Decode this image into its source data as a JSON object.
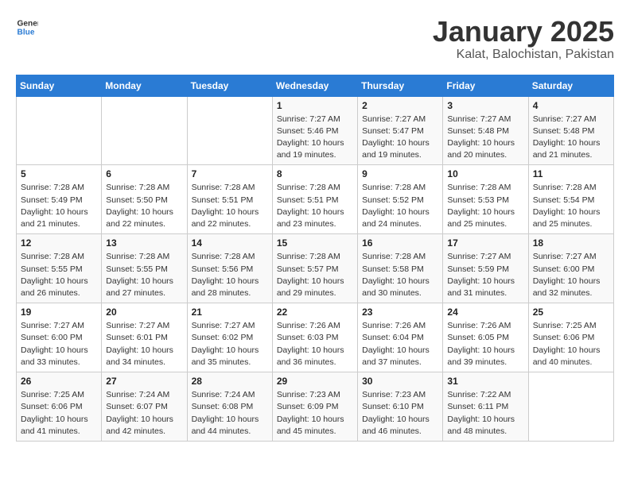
{
  "logo": {
    "line1": "General",
    "line2": "Blue"
  },
  "title": "January 2025",
  "subtitle": "Kalat, Balochistan, Pakistan",
  "days_header": [
    "Sunday",
    "Monday",
    "Tuesday",
    "Wednesday",
    "Thursday",
    "Friday",
    "Saturday"
  ],
  "weeks": [
    [
      {
        "day": "",
        "sunrise": "",
        "sunset": "",
        "daylight": ""
      },
      {
        "day": "",
        "sunrise": "",
        "sunset": "",
        "daylight": ""
      },
      {
        "day": "",
        "sunrise": "",
        "sunset": "",
        "daylight": ""
      },
      {
        "day": "1",
        "sunrise": "Sunrise: 7:27 AM",
        "sunset": "Sunset: 5:46 PM",
        "daylight": "Daylight: 10 hours and 19 minutes."
      },
      {
        "day": "2",
        "sunrise": "Sunrise: 7:27 AM",
        "sunset": "Sunset: 5:47 PM",
        "daylight": "Daylight: 10 hours and 19 minutes."
      },
      {
        "day": "3",
        "sunrise": "Sunrise: 7:27 AM",
        "sunset": "Sunset: 5:48 PM",
        "daylight": "Daylight: 10 hours and 20 minutes."
      },
      {
        "day": "4",
        "sunrise": "Sunrise: 7:27 AM",
        "sunset": "Sunset: 5:48 PM",
        "daylight": "Daylight: 10 hours and 21 minutes."
      }
    ],
    [
      {
        "day": "5",
        "sunrise": "Sunrise: 7:28 AM",
        "sunset": "Sunset: 5:49 PM",
        "daylight": "Daylight: 10 hours and 21 minutes."
      },
      {
        "day": "6",
        "sunrise": "Sunrise: 7:28 AM",
        "sunset": "Sunset: 5:50 PM",
        "daylight": "Daylight: 10 hours and 22 minutes."
      },
      {
        "day": "7",
        "sunrise": "Sunrise: 7:28 AM",
        "sunset": "Sunset: 5:51 PM",
        "daylight": "Daylight: 10 hours and 22 minutes."
      },
      {
        "day": "8",
        "sunrise": "Sunrise: 7:28 AM",
        "sunset": "Sunset: 5:51 PM",
        "daylight": "Daylight: 10 hours and 23 minutes."
      },
      {
        "day": "9",
        "sunrise": "Sunrise: 7:28 AM",
        "sunset": "Sunset: 5:52 PM",
        "daylight": "Daylight: 10 hours and 24 minutes."
      },
      {
        "day": "10",
        "sunrise": "Sunrise: 7:28 AM",
        "sunset": "Sunset: 5:53 PM",
        "daylight": "Daylight: 10 hours and 25 minutes."
      },
      {
        "day": "11",
        "sunrise": "Sunrise: 7:28 AM",
        "sunset": "Sunset: 5:54 PM",
        "daylight": "Daylight: 10 hours and 25 minutes."
      }
    ],
    [
      {
        "day": "12",
        "sunrise": "Sunrise: 7:28 AM",
        "sunset": "Sunset: 5:55 PM",
        "daylight": "Daylight: 10 hours and 26 minutes."
      },
      {
        "day": "13",
        "sunrise": "Sunrise: 7:28 AM",
        "sunset": "Sunset: 5:55 PM",
        "daylight": "Daylight: 10 hours and 27 minutes."
      },
      {
        "day": "14",
        "sunrise": "Sunrise: 7:28 AM",
        "sunset": "Sunset: 5:56 PM",
        "daylight": "Daylight: 10 hours and 28 minutes."
      },
      {
        "day": "15",
        "sunrise": "Sunrise: 7:28 AM",
        "sunset": "Sunset: 5:57 PM",
        "daylight": "Daylight: 10 hours and 29 minutes."
      },
      {
        "day": "16",
        "sunrise": "Sunrise: 7:28 AM",
        "sunset": "Sunset: 5:58 PM",
        "daylight": "Daylight: 10 hours and 30 minutes."
      },
      {
        "day": "17",
        "sunrise": "Sunrise: 7:27 AM",
        "sunset": "Sunset: 5:59 PM",
        "daylight": "Daylight: 10 hours and 31 minutes."
      },
      {
        "day": "18",
        "sunrise": "Sunrise: 7:27 AM",
        "sunset": "Sunset: 6:00 PM",
        "daylight": "Daylight: 10 hours and 32 minutes."
      }
    ],
    [
      {
        "day": "19",
        "sunrise": "Sunrise: 7:27 AM",
        "sunset": "Sunset: 6:00 PM",
        "daylight": "Daylight: 10 hours and 33 minutes."
      },
      {
        "day": "20",
        "sunrise": "Sunrise: 7:27 AM",
        "sunset": "Sunset: 6:01 PM",
        "daylight": "Daylight: 10 hours and 34 minutes."
      },
      {
        "day": "21",
        "sunrise": "Sunrise: 7:27 AM",
        "sunset": "Sunset: 6:02 PM",
        "daylight": "Daylight: 10 hours and 35 minutes."
      },
      {
        "day": "22",
        "sunrise": "Sunrise: 7:26 AM",
        "sunset": "Sunset: 6:03 PM",
        "daylight": "Daylight: 10 hours and 36 minutes."
      },
      {
        "day": "23",
        "sunrise": "Sunrise: 7:26 AM",
        "sunset": "Sunset: 6:04 PM",
        "daylight": "Daylight: 10 hours and 37 minutes."
      },
      {
        "day": "24",
        "sunrise": "Sunrise: 7:26 AM",
        "sunset": "Sunset: 6:05 PM",
        "daylight": "Daylight: 10 hours and 39 minutes."
      },
      {
        "day": "25",
        "sunrise": "Sunrise: 7:25 AM",
        "sunset": "Sunset: 6:06 PM",
        "daylight": "Daylight: 10 hours and 40 minutes."
      }
    ],
    [
      {
        "day": "26",
        "sunrise": "Sunrise: 7:25 AM",
        "sunset": "Sunset: 6:06 PM",
        "daylight": "Daylight: 10 hours and 41 minutes."
      },
      {
        "day": "27",
        "sunrise": "Sunrise: 7:24 AM",
        "sunset": "Sunset: 6:07 PM",
        "daylight": "Daylight: 10 hours and 42 minutes."
      },
      {
        "day": "28",
        "sunrise": "Sunrise: 7:24 AM",
        "sunset": "Sunset: 6:08 PM",
        "daylight": "Daylight: 10 hours and 44 minutes."
      },
      {
        "day": "29",
        "sunrise": "Sunrise: 7:23 AM",
        "sunset": "Sunset: 6:09 PM",
        "daylight": "Daylight: 10 hours and 45 minutes."
      },
      {
        "day": "30",
        "sunrise": "Sunrise: 7:23 AM",
        "sunset": "Sunset: 6:10 PM",
        "daylight": "Daylight: 10 hours and 46 minutes."
      },
      {
        "day": "31",
        "sunrise": "Sunrise: 7:22 AM",
        "sunset": "Sunset: 6:11 PM",
        "daylight": "Daylight: 10 hours and 48 minutes."
      },
      {
        "day": "",
        "sunrise": "",
        "sunset": "",
        "daylight": ""
      }
    ]
  ]
}
